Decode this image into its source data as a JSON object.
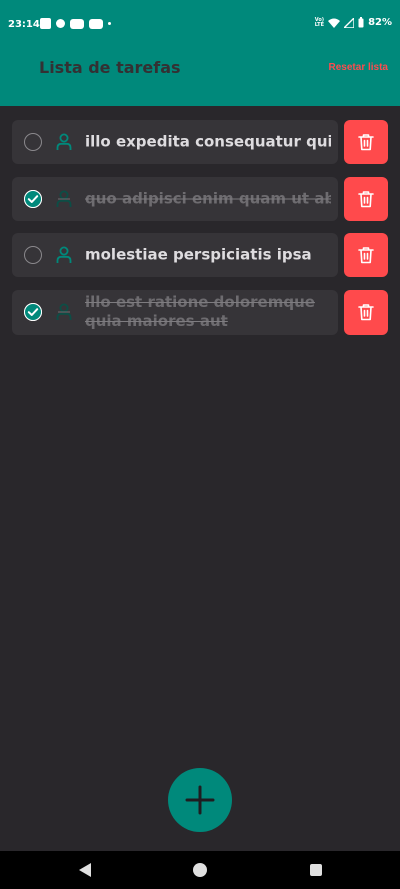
{
  "status_bar": {
    "time": "23:14",
    "network": "LTE",
    "battery": "82%",
    "icons_left": [
      "linkedin-icon",
      "app-icon",
      "youtube-icon",
      "youtube-icon",
      "dot-icon"
    ],
    "icons_right": [
      "volte-icon",
      "wifi-icon",
      "signal-icon",
      "battery-icon"
    ]
  },
  "header": {
    "title": "Lista de tarefas",
    "reset_label": "Resetar lista",
    "background": "#00897b"
  },
  "tasks": [
    {
      "text": "illo expedita consequatur quia in",
      "completed": false
    },
    {
      "text": "quo adipisci enim quam ut ab",
      "completed": true
    },
    {
      "text": "molestiae perspiciatis ipsa",
      "completed": false
    },
    {
      "text": "illo est ratione doloremque quia maiores aut",
      "completed": true
    }
  ],
  "icons": {
    "task_person": "person-icon",
    "delete": "trash-icon",
    "fab": "plus-icon",
    "check": "check-icon"
  },
  "colors": {
    "accent": "#00897b",
    "danger": "#ff4a4c",
    "background": "#29272b",
    "card": "#363438"
  },
  "nav_bar": {
    "buttons": [
      "back",
      "home",
      "recents"
    ]
  }
}
